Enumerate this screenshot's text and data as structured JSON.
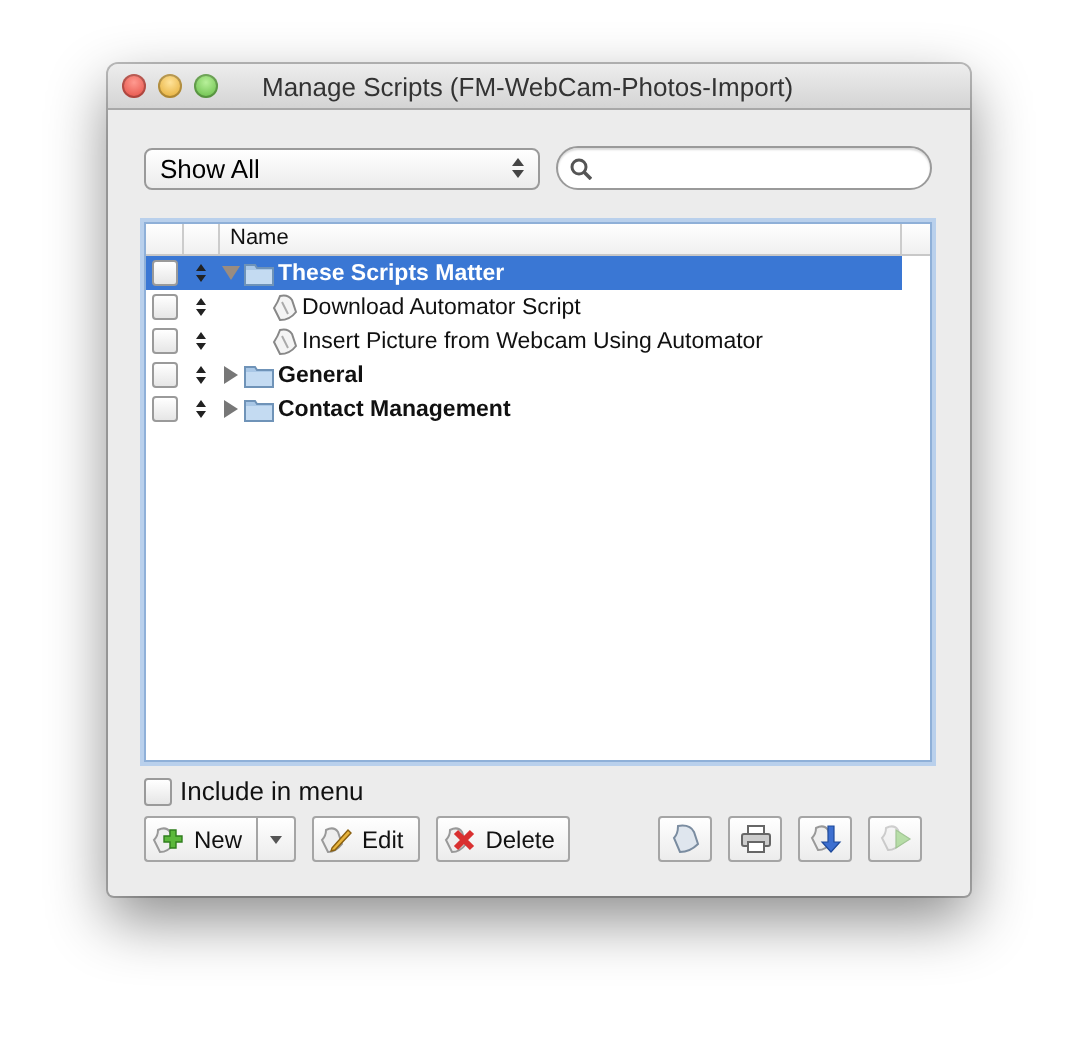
{
  "window": {
    "title": "Manage Scripts (FM-WebCam-Photos-Import)"
  },
  "filter": {
    "value": "Show All"
  },
  "tree": {
    "columns": [
      "Name"
    ],
    "items": [
      {
        "name": "These Scripts Matter",
        "kind": "folder",
        "expanded": true,
        "selected": true,
        "checked": false,
        "children": [
          {
            "name": "Download Automator Script",
            "kind": "script",
            "selected": false,
            "checked": false
          },
          {
            "name": "Insert Picture from Webcam Using Automator",
            "kind": "script",
            "selected": false,
            "checked": false
          }
        ]
      },
      {
        "name": "General",
        "kind": "folder",
        "expanded": false,
        "selected": false,
        "checked": false
      },
      {
        "name": "Contact Management",
        "kind": "folder",
        "expanded": false,
        "selected": false,
        "checked": false
      }
    ]
  },
  "include_in_menu": {
    "label": "Include in menu",
    "checked": false
  },
  "buttons": [
    {
      "label": "New",
      "kind": "new"
    },
    {
      "label": "Edit",
      "kind": "edit"
    },
    {
      "label": "Delete",
      "kind": "delete"
    }
  ],
  "tool_buttons": [
    {
      "kind": "script",
      "disabled": false
    },
    {
      "kind": "print",
      "disabled": false
    },
    {
      "kind": "import",
      "disabled": false
    },
    {
      "kind": "run",
      "disabled": true
    }
  ]
}
